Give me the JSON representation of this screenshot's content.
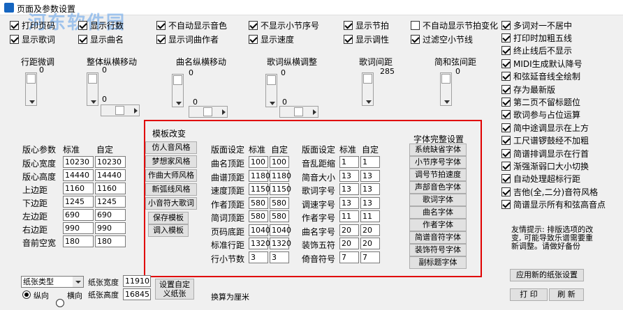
{
  "window": {
    "title": "页面及参数设置",
    "watermark": "河东软件园"
  },
  "top_checks": [
    {
      "label": "打印页码",
      "checked": true
    },
    {
      "label": "显示行数",
      "checked": true
    },
    {
      "label": "不自动显示音色",
      "checked": true
    },
    {
      "label": "不显示小节序号",
      "checked": true
    },
    {
      "label": "显示节拍",
      "checked": true
    },
    {
      "label": "不自动显示节拍变化",
      "checked": false
    },
    {
      "label": "显示歌词",
      "checked": true
    },
    {
      "label": "显示曲名",
      "checked": true
    },
    {
      "label": "显示词曲作者",
      "checked": true
    },
    {
      "label": "显示速度",
      "checked": true
    },
    {
      "label": "显示调性",
      "checked": true
    },
    {
      "label": "过滤空小节线",
      "checked": true
    }
  ],
  "right_checks": [
    {
      "label": "多词对一不居中",
      "checked": true
    },
    {
      "label": "打印时加粗五线",
      "checked": true
    },
    {
      "label": "终止线后不显示",
      "checked": true
    },
    {
      "label": "MIDI生成默认降号",
      "checked": true
    },
    {
      "label": "和弦延音线全绘制",
      "checked": true
    },
    {
      "label": "存为最新版",
      "checked": true
    },
    {
      "label": "第二页不留标题位",
      "checked": true
    },
    {
      "label": "歌词参与占位运算",
      "checked": true
    },
    {
      "label": "简中途调显示在上方",
      "checked": true
    },
    {
      "label": "工尺谱锣鼓经不加粗",
      "checked": true
    },
    {
      "label": "简谱排调显示在行首",
      "checked": true
    },
    {
      "label": "渐强渐弱口大小切换",
      "checked": true
    },
    {
      "label": "自动处理超标行距",
      "checked": true
    },
    {
      "label": "吉他(全,二分)音符风格",
      "checked": true
    },
    {
      "label": "简谱显示所有和弦高音点",
      "checked": true
    }
  ],
  "adjusters": {
    "row_fine": {
      "label": "行距微调",
      "value": "0"
    },
    "whole": {
      "label": "整体纵横移动",
      "v_value": "0",
      "h_value": "0"
    },
    "title_move": {
      "label": "曲名纵横移动",
      "v_value": "0",
      "h_value": "0"
    },
    "lyric_adj": {
      "label": "歌词纵横调整",
      "v_value": "0",
      "h_value": "0"
    },
    "lyric_gap": {
      "label": "歌词间距",
      "value": "285"
    },
    "chord_gap": {
      "label": "简和弦间距",
      "value": "0"
    }
  },
  "layout_params": {
    "heading": "版心参数",
    "std_label": "标准",
    "custom_label": "自定",
    "rows": [
      {
        "label": "版心宽度",
        "std": "10230",
        "custom": "10230"
      },
      {
        "label": "版心高度",
        "std": "14440",
        "custom": "14440"
      },
      {
        "label": "上边距",
        "std": "1160",
        "custom": "1160"
      },
      {
        "label": "下边距",
        "std": "1245",
        "custom": "1245"
      },
      {
        "label": "左边距",
        "std": "690",
        "custom": "690"
      },
      {
        "label": "右边距",
        "std": "990",
        "custom": "990"
      },
      {
        "label": "音前空宽",
        "std": "180",
        "custom": "180"
      }
    ]
  },
  "template": {
    "heading": "模板改变",
    "buttons": [
      "仿人音风格",
      "梦想家风格",
      "作曲大师风格",
      "新弧线风格",
      "小音符大歌词"
    ],
    "save": "保存模板",
    "load": "调入模板"
  },
  "page_setting1": {
    "heading": "版面设定",
    "std_label": "标准",
    "custom_label": "自定",
    "rows": [
      {
        "label": "曲名顶距",
        "std": "100",
        "custom": "100"
      },
      {
        "label": "曲谱顶距",
        "std": "1180",
        "custom": "1180"
      },
      {
        "label": "速度顶距",
        "std": "1150",
        "custom": "1150"
      },
      {
        "label": "作者顶距",
        "std": "580",
        "custom": "580"
      },
      {
        "label": "简词顶距",
        "std": "580",
        "custom": "580"
      },
      {
        "label": "页码底距",
        "std": "1040",
        "custom": "1040"
      },
      {
        "label": "标准行距",
        "std": "1320",
        "custom": "1320"
      },
      {
        "label": "行小节数",
        "std": "3",
        "custom": "3"
      }
    ]
  },
  "page_setting2": {
    "heading": "版面设定",
    "std_label": "标准",
    "custom_label": "自定",
    "rows": [
      {
        "label": "音乱距缩",
        "std": "1",
        "custom": "1"
      },
      {
        "label": "简音大小",
        "std": "13",
        "custom": "13"
      },
      {
        "label": "歌词字号",
        "std": "13",
        "custom": "13"
      },
      {
        "label": "调速字号",
        "std": "13",
        "custom": "13"
      },
      {
        "label": "作者字号",
        "std": "11",
        "custom": "11"
      },
      {
        "label": "曲名字号",
        "std": "20",
        "custom": "20"
      },
      {
        "label": "装饰五符",
        "std": "20",
        "custom": "20"
      },
      {
        "label": "倚音符号",
        "std": "7",
        "custom": "7"
      }
    ]
  },
  "fonts": {
    "heading": "字体完整设置",
    "buttons": [
      "系统缺省字体",
      "小节序号字体",
      "调号节拍速度",
      "声部音色字体",
      "歌词字体",
      "曲名字体",
      "作者字体",
      "简谱音符字体",
      "装饰符号字体",
      "副标题字体"
    ]
  },
  "tip": "友情提示: 排版选项的改变, 可能导致乐谱需要重新调整。请做好备份",
  "paper": {
    "type": "纸张类型",
    "width_label": "纸张宽度",
    "width": "11910",
    "height_label": "纸张高度",
    "height": "16845",
    "custom_btn": "设置自定义纸张",
    "portrait": "纵向",
    "landscape": "横向",
    "unit_note": "换算为厘米"
  },
  "actions": {
    "apply": "应用新的纸张设置",
    "print": "打 印",
    "refresh": "刷 新"
  }
}
